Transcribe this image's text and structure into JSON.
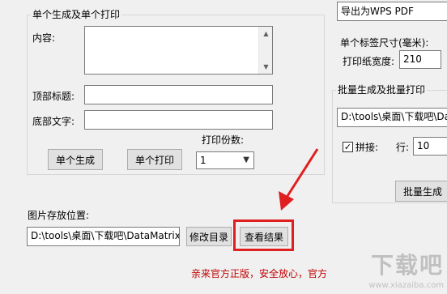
{
  "left": {
    "single_group_title": "单个生成及单个打印",
    "content_label": "内容:",
    "content_value": "",
    "top_title_label": "顶部标题:",
    "top_title_value": "",
    "bottom_text_label": "底部文字:",
    "bottom_text_value": "",
    "copies_label": "打印份数:",
    "copies_value": "1",
    "single_generate_label": "单个生成",
    "single_print_label": "单个打印",
    "image_path_label": "图片存放位置:",
    "image_path_value": "D:\\tools\\桌面\\下载吧\\DataMatrixG",
    "change_dir_label": "修改目录",
    "view_results_label": "查看结果",
    "footer_text": "亲来官方正版，安全放心，官方"
  },
  "right": {
    "export_format_value": "导出为WPS PDF",
    "label_size_label": "单个标签尺寸(毫米):",
    "paper_width_label": "打印纸宽度:",
    "paper_width_value": "210",
    "batch_group_title": "批量生成及批量打印",
    "batch_path_value": "D:\\tools\\桌面\\下载吧\\Data",
    "splice_label": "拼接:",
    "splice_checked": true,
    "row_label": "行:",
    "row_value": "10",
    "batch_generate_label": "批量生成"
  },
  "watermark": {
    "text": "下载吧",
    "url": "www.xiazaiba.com"
  },
  "colors": {
    "highlight": "#e02020",
    "arrow": "#e02020",
    "footer_text": "#c00000"
  }
}
